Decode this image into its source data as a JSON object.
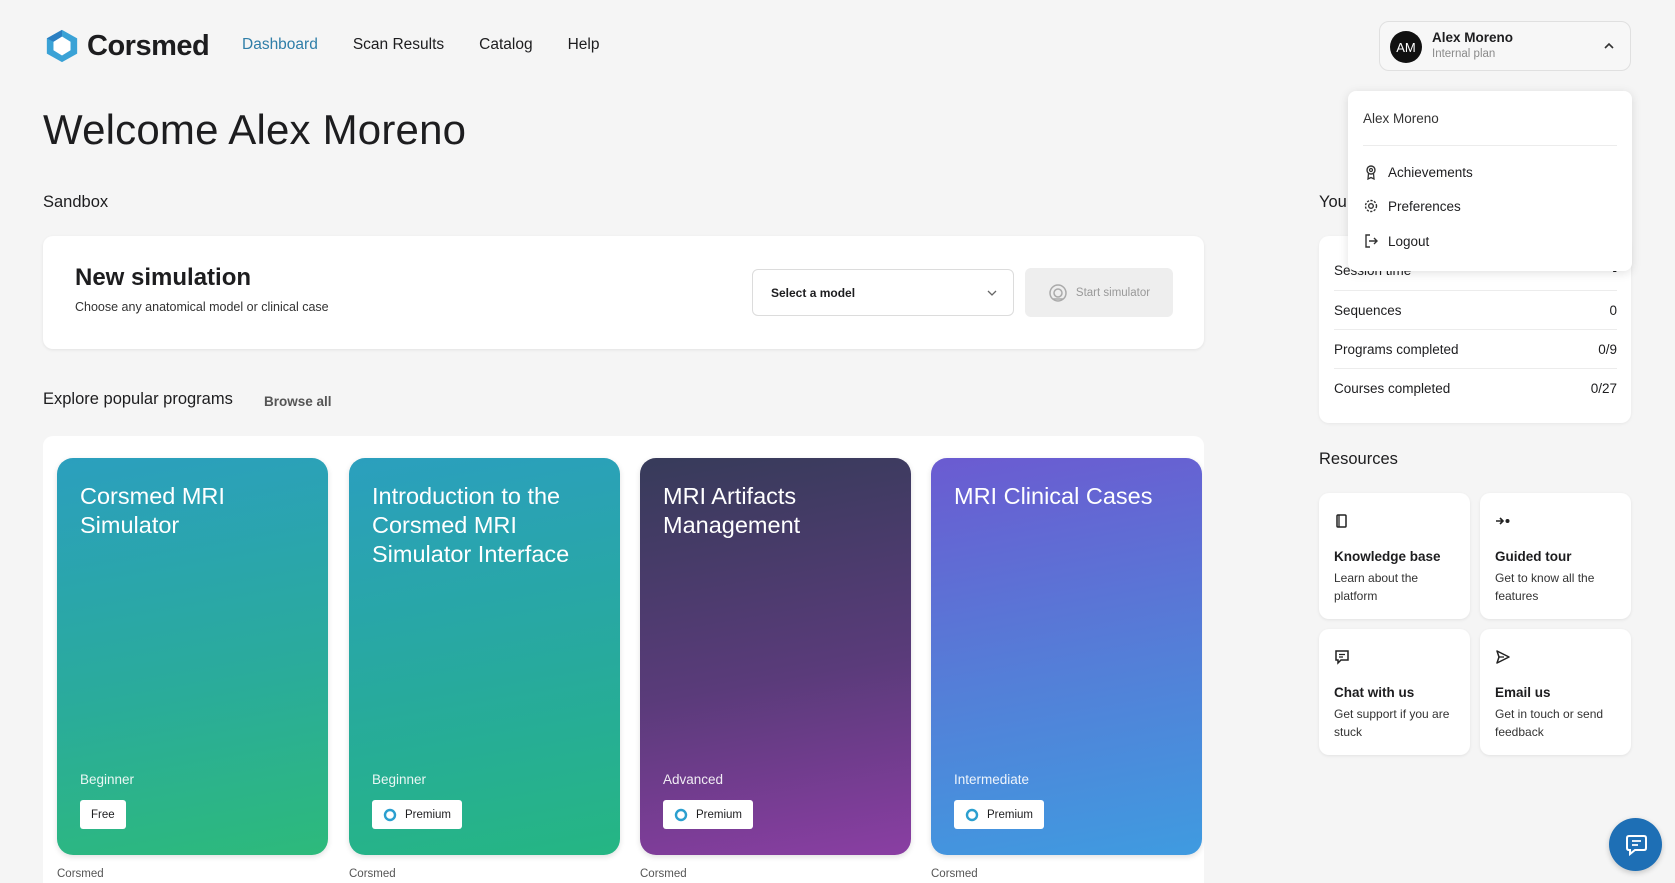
{
  "brand": {
    "name": "Corsmed"
  },
  "nav": {
    "items": [
      "Dashboard",
      "Scan Results",
      "Catalog",
      "Help"
    ],
    "active": "Dashboard"
  },
  "user": {
    "initials": "AM",
    "name": "Alex Moreno",
    "plan": "Internal plan"
  },
  "user_menu": {
    "name": "Alex Moreno",
    "items": [
      {
        "label": "Achievements",
        "icon": "award-icon"
      },
      {
        "label": "Preferences",
        "icon": "gear-icon"
      },
      {
        "label": "Logout",
        "icon": "logout-icon"
      }
    ]
  },
  "welcome": "Welcome Alex Moreno",
  "sandbox": {
    "heading": "Sandbox",
    "title": "New simulation",
    "subtitle": "Choose any anatomical model or clinical case",
    "select_placeholder": "Select a model",
    "start_label": "Start simulator"
  },
  "explore": {
    "heading": "Explore popular programs",
    "browse_all": "Browse all",
    "programs": [
      {
        "title": "Corsmed MRI Simulator",
        "level": "Beginner",
        "badge": "Free",
        "badge_icon": "",
        "author": "Corsmed"
      },
      {
        "title": "Introduction to the Corsmed MRI Simulator Interface",
        "level": "Beginner",
        "badge": "Premium",
        "badge_icon": "corsmed-logo-icon",
        "author": "Corsmed"
      },
      {
        "title": "MRI Artifacts Management",
        "level": "Advanced",
        "badge": "Premium",
        "badge_icon": "corsmed-logo-icon",
        "author": "Corsmed"
      },
      {
        "title": "MRI Clinical Cases",
        "level": "Intermediate",
        "badge": "Premium",
        "badge_icon": "corsmed-logo-icon",
        "author": "Corsmed"
      }
    ]
  },
  "stats": {
    "heading": "You",
    "rows": [
      {
        "label": "Session time",
        "value": "-"
      },
      {
        "label": "Sequences",
        "value": "0"
      },
      {
        "label": "Programs completed",
        "value": "0/9"
      },
      {
        "label": "Courses completed",
        "value": "0/27"
      }
    ]
  },
  "resources": {
    "heading": "Resources",
    "items": [
      {
        "title": "Knowledge base",
        "desc": "Learn about the platform",
        "icon": "book-icon"
      },
      {
        "title": "Guided tour",
        "desc": "Get to know all the features",
        "icon": "tour-icon"
      },
      {
        "title": "Chat with us",
        "desc": "Get support if you are stuck",
        "icon": "chat-icon"
      },
      {
        "title": "Email us",
        "desc": "Get in touch or send feedback",
        "icon": "send-icon"
      }
    ]
  },
  "colors": {
    "accent": "#2f7ea8",
    "fab": "#1e6fb5"
  }
}
